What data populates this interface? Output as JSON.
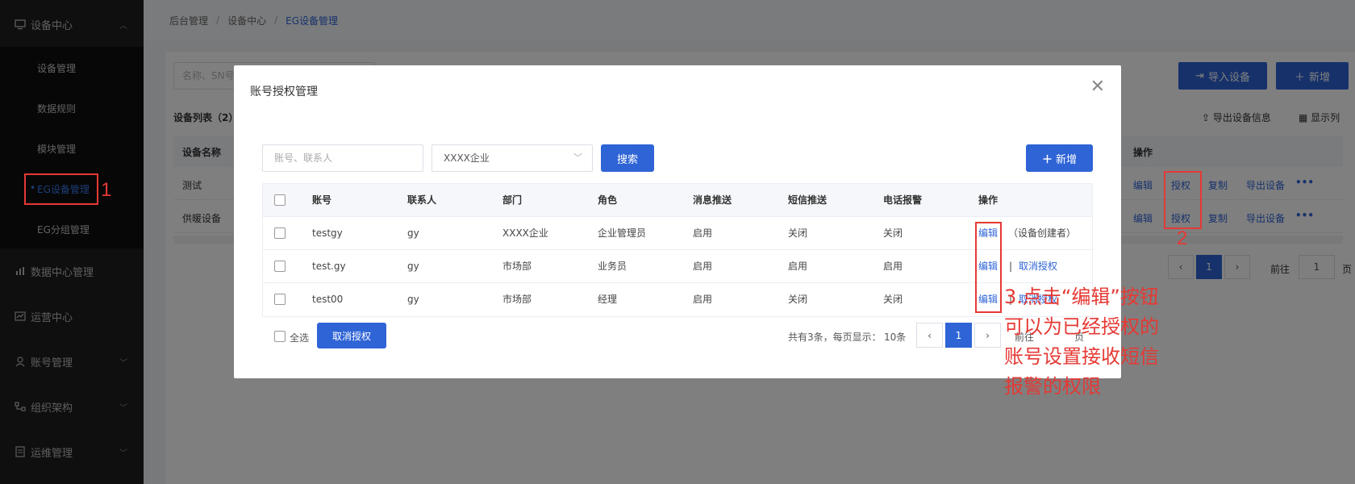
{
  "sidebar": {
    "device_center": "设备中心",
    "items": [
      "设备管理",
      "数据规则",
      "模块管理",
      "EG设备管理",
      "EG分组管理"
    ],
    "groups": [
      "数据中心管理",
      "运营中心",
      "账号管理",
      "组织架构",
      "运维管理"
    ]
  },
  "breadcrumb": [
    "后台管理",
    "设备中心",
    "EG设备管理"
  ],
  "background": {
    "search_placeholder": "名称、SN号",
    "import_button": "导入设备",
    "add_button": "新增",
    "list_title": "设备列表（2）",
    "export_info": "导出设备信息",
    "display_columns": "显示列",
    "col_name": "设备名称",
    "col_ops": "操作",
    "rows": [
      {
        "name": "测试",
        "ops": [
          "编辑",
          "授权",
          "复制",
          "导出设备",
          "•••"
        ]
      },
      {
        "name": "供暖设备",
        "ops": [
          "编辑",
          "授权",
          "复制",
          "导出设备",
          "•••"
        ]
      }
    ],
    "pager_current": "1",
    "goto_label": "前往",
    "goto_value": "1",
    "page_suffix": "页"
  },
  "dialog": {
    "title": "账号授权管理",
    "search_placeholder": "账号、联系人",
    "company_select": "XXXX企业",
    "search_button": "搜索",
    "add_button": "新增",
    "columns": [
      "账号",
      "联系人",
      "部门",
      "角色",
      "消息推送",
      "短信推送",
      "电话报警",
      "操作"
    ],
    "rows": [
      {
        "account": "testgy",
        "contact": "gy",
        "dept": "XXXX企业",
        "role": "企业管理员",
        "msg": "启用",
        "sms": "关闭",
        "phone": "关闭",
        "edit": "编辑",
        "extra": "（设备创建者）",
        "extra_is_link": false
      },
      {
        "account": "test.gy",
        "contact": "gy",
        "dept": "市场部",
        "role": "业务员",
        "msg": "启用",
        "sms": "启用",
        "phone": "启用",
        "edit": "编辑",
        "extra": "取消授权",
        "extra_is_link": true
      },
      {
        "account": "test00",
        "contact": "gy",
        "dept": "市场部",
        "role": "经理",
        "msg": "启用",
        "sms": "关闭",
        "phone": "关闭",
        "edit": "编辑",
        "extra": "取消授权",
        "extra_is_link": true
      }
    ],
    "select_all": "全选",
    "revoke_button": "取消授权",
    "total_text": "共有3条，每页显示：",
    "page_size": "10条",
    "pager_current": "1",
    "goto_label": "前往",
    "page_suffix": "页"
  },
  "annotations": {
    "num1": "1",
    "num2": "2",
    "note": "3.点击“编辑”按钮\n可以为已经授权的\n账号设置接收短信\n报警的权限"
  },
  "colors": {
    "accent": "#2f64d6",
    "annotation": "#e53935",
    "sidebar_bg": "#1f1f1f"
  }
}
